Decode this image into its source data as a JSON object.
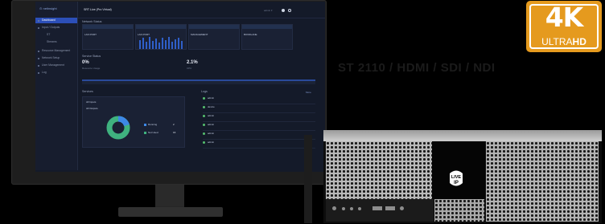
{
  "app": {
    "logo": "⊙ netinsight",
    "page_title": "SRT Live (Pro Virtual)",
    "user_menu": "admin ▾",
    "sidebar": [
      {
        "label": "Dashboard",
        "active": true
      },
      {
        "label": "Input / Outputs"
      },
      {
        "label": "ST"
      },
      {
        "label": "Streams"
      },
      {
        "label": "Resource Management"
      },
      {
        "label": "Network Setup"
      },
      {
        "label": "User Management"
      },
      {
        "label": "Log"
      }
    ],
    "network_section": "Network Status",
    "network_cards": [
      "LAN PORT",
      "LAN PORT",
      "MANAGEMENT",
      "BONDLANE"
    ],
    "service_section": "Service Status",
    "stat1_value": "0%",
    "stat1_label": "Resource Usage",
    "stat2_value": "2.1%",
    "stat2_label": "CPU",
    "services_title": "Services",
    "services_rows": [
      "All Inputs",
      "All Outputs"
    ],
    "legend": [
      {
        "label": "Running",
        "value": "2",
        "color": "#3d88e6"
      },
      {
        "label": "Not Used",
        "value": "16",
        "color": "#3fb27f"
      }
    ],
    "logs_title": "Logs",
    "logs_link": "More",
    "events": [
      "admin",
      "device",
      "admin",
      "admin",
      "admin",
      "admin"
    ]
  },
  "headline": "ST 2110 / HDMI / SDI / NDI",
  "badge": {
    "number": "4K",
    "sub_a": "ULTRA",
    "sub_b": "HD",
    "color": "#e59a1e"
  },
  "server": {
    "logo_line1": "LIVE",
    "logo_line2": "IP"
  }
}
